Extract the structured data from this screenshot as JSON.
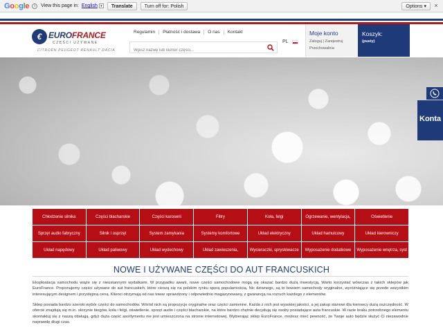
{
  "translate_bar": {
    "logo_text": "Google",
    "view_label": "View this page in:",
    "language": "English",
    "translate_button": "Translate",
    "turn_off_button": "Turn off for: Polish",
    "options_button": "Options ▾",
    "close_symbol": "×"
  },
  "header": {
    "logo": {
      "brand_prefix": "EURO",
      "brand_suffix": "FRANCE",
      "tagline": "CZĘŚCI UŻYWANE",
      "brands": "CITROËN  PEUGEOT  RENAULT  DACIA"
    },
    "nav": [
      "Regulamin",
      "Płatność i dostawa",
      "O nas",
      "Kontakt"
    ],
    "search": {
      "placeholder": "Wpisz nazwę lub numer części..."
    },
    "language_code": "PL",
    "account": {
      "title": "Moje konto",
      "links": "Zaloguj | Zarejestruj",
      "storage": "Przechowalnia"
    },
    "cart": {
      "title": "Koszyk:",
      "status": "(pusty)"
    }
  },
  "hero": {
    "side_tab_label": "Konta"
  },
  "categories": [
    "Chłodzenie silnika",
    "Części blacharskie",
    "Części karoserii",
    "Filtry",
    "Koła, felgi",
    "Ogrzewanie, wentylacja,",
    "Oświetlenie",
    "Sprzęt audio fabryczny",
    "Silnik i osprzęt",
    "System zamykania",
    "Systemy komfortowe",
    "Układ elektryczny",
    "Układ hamulcowy",
    "Układ kierowniczy",
    "Układ napędowy",
    "Układ paliwowy",
    "Układ wydechowy",
    "Układ zawieszenia,",
    "Wycieraczki, spryskiwacze",
    "Wyposażenie dodatkowe",
    "Wyposażenie wnętrza, syst"
  ],
  "content": {
    "title": "NOWE I UŻYWANE CZĘŚCI DO AUT FRANCUSKICH",
    "paragraph_1": "Eksploatacja samochodu wiąże się z nieustannymi wydatkami. W przypadku awarii, nowe części samochodowe mogą się okazać bardzo dużą inwestycją. Warto korzystać wówczas z takich sklepów jak EuroFrance. Proponujemy części używane do aut francuskich, które cieszą się na polskim rynku sporą popularnością. Nic dziwnego, są to bowiem samochody oryginalne, wyróżniające się przede wszystkim interesującym designem i przystępną ceną. Klienci otrzymują od nas towar sprawdzony i odpowiednio magazynowany, z gwarancją na rozruch każdego z elementów.",
    "paragraph_2": "Sklep posiada bardzo szeroki wybór części do samochodów. Wśród nich są propozycje oryginalne oraz części zamienne. Każda z nich jest wysokiej jakości, a jej zakup stanowi dla kierowcy dużą oszczędność. W ofercie znajdują się m.in. skrzynie biegów, koła i felgi, oświetlenie, sprzęt audio i części blacharskie, na które bardzo chętnie decydują się osoby posiadające auta francuskie. W razie braku potrzebnego elementu skontaktuj się z naszą obsługą, gdyż duża część asortymentu nie jest umieszczona na stronie internetowej. Wybierając sklep EuroFrance, możesz mieć pewność, że Twoje auto będzie służyć Ci niezawodnie naprawdę długi czas."
  },
  "colors": {
    "brand_blue": "#1f3a78",
    "brand_red": "#b50e14"
  }
}
